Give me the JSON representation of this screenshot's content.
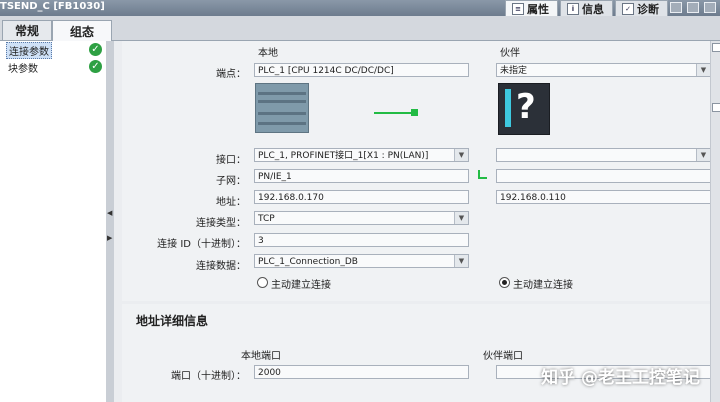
{
  "window": {
    "title": "TSEND_C [FB1030]"
  },
  "top_tabs": [
    {
      "label": "属性",
      "icon": "properties-icon"
    },
    {
      "label": "信息",
      "icon": "info-icon"
    },
    {
      "label": "诊断",
      "icon": "diagnostics-icon"
    }
  ],
  "sub_tabs": [
    "常规",
    "组态"
  ],
  "nav": [
    {
      "label": "连接参数",
      "status": "ok"
    },
    {
      "label": "块参数",
      "status": "ok"
    }
  ],
  "form": {
    "col_local": "本地",
    "col_partner": "伙伴",
    "endpoint": {
      "label": "端点：",
      "local": "PLC_1 [CPU 1214C DC/DC/DC]",
      "partner": "未指定"
    },
    "interface": {
      "label": "接口：",
      "local": "PLC_1, PROFINET接口_1[X1 : PN(LAN)]",
      "partner": ""
    },
    "subnet": {
      "label": "子网：",
      "local": "PN/IE_1",
      "partner": ""
    },
    "address": {
      "label": "地址：",
      "local": "192.168.0.170",
      "partner": "192.168.0.110"
    },
    "conn_type": {
      "label": "连接类型：",
      "value": "TCP"
    },
    "conn_id": {
      "label": "连接 ID（十进制）：",
      "value": "3"
    },
    "conn_data": {
      "label": "连接数据：",
      "value": "PLC_1_Connection_DB"
    },
    "active_local": {
      "label": "主动建立连接",
      "checked": false
    },
    "active_partner": {
      "label": "主动建立连接",
      "checked": true
    }
  },
  "address_detail": {
    "title": "地址详细信息",
    "col_local": "本地端口",
    "col_partner": "伙伴端口",
    "port_label": "端口（十进制）：",
    "local_port": "2000",
    "partner_port": ""
  },
  "watermark": "知乎 @老王工控笔记",
  "colors": {
    "ok": "#2ea043",
    "link_line": "#22bb44",
    "device_accent": "#3ec9e0"
  }
}
